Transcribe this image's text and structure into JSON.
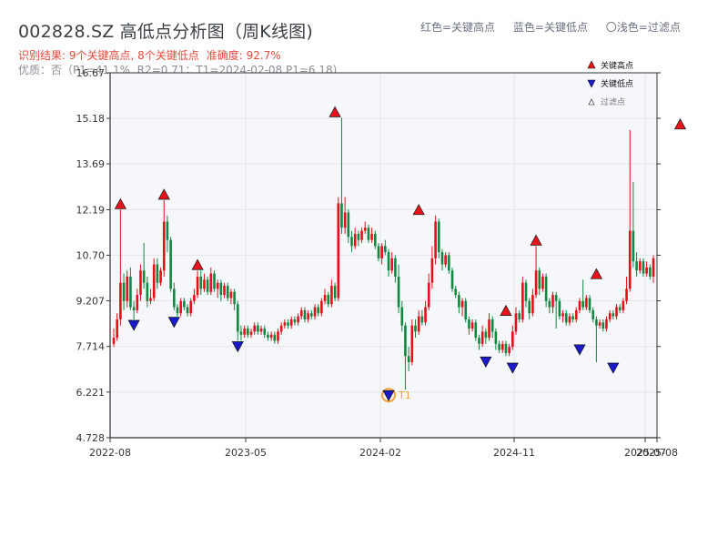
{
  "header": {
    "title": "002828.SZ 高低点分析图（周K线图)",
    "legend_line": [
      "红色=关键高点",
      "蓝色=关键低点",
      "〇浅色=过滤点"
    ],
    "result_text": "识别结果: 9个关键高点, 8个关键低点",
    "accuracy_text": "准确度: 92.7%",
    "quality_text": "优质：否（P1=41.1%, R2=0.71；T1=2024-02-08 P1=6.18)"
  },
  "colors": {
    "up": "#e3101a",
    "down": "#12873f",
    "high": "#e8141c",
    "low": "#1a1acb",
    "t1": "#f0a13a",
    "plot_bg": "#f5f7fa"
  },
  "chart_data": {
    "type": "candlestick",
    "ylim": [
      4.728,
      16.67
    ],
    "yticks": [
      "4.728",
      "6.221",
      "7.714",
      "9.207",
      "10.70",
      "12.19",
      "13.69",
      "15.18",
      "16.67"
    ],
    "xticks": [
      "2022-08",
      "2023-05",
      "2024-02",
      "2024-11",
      "2025-07",
      "2025-08"
    ],
    "legend": [
      "关键高点",
      "关键低点",
      "过滤点"
    ],
    "grid": true,
    "annotation": "T1",
    "candles": [
      {
        "o": 7.8,
        "c": 8.0,
        "h": 8.3,
        "l": 7.7
      },
      {
        "o": 8.0,
        "c": 8.6,
        "h": 8.8,
        "l": 7.9
      },
      {
        "o": 8.6,
        "c": 9.8,
        "h": 12.2,
        "l": 8.4
      },
      {
        "o": 9.8,
        "c": 9.2,
        "h": 10.1,
        "l": 8.9
      },
      {
        "o": 9.2,
        "c": 10.0,
        "h": 10.2,
        "l": 9.0
      },
      {
        "o": 10.0,
        "c": 9.0,
        "h": 10.3,
        "l": 8.9
      },
      {
        "o": 9.0,
        "c": 8.9,
        "h": 9.2,
        "l": 8.6
      },
      {
        "o": 8.9,
        "c": 9.4,
        "h": 9.6,
        "l": 8.8
      },
      {
        "o": 9.4,
        "c": 10.2,
        "h": 10.4,
        "l": 9.2
      },
      {
        "o": 10.2,
        "c": 9.8,
        "h": 11.1,
        "l": 9.6
      },
      {
        "o": 9.8,
        "c": 9.2,
        "h": 10.0,
        "l": 9.0
      },
      {
        "o": 9.2,
        "c": 9.3,
        "h": 9.6,
        "l": 9.1
      },
      {
        "o": 9.3,
        "c": 10.4,
        "h": 10.6,
        "l": 9.2
      },
      {
        "o": 10.4,
        "c": 9.8,
        "h": 10.6,
        "l": 9.6
      },
      {
        "o": 9.8,
        "c": 10.2,
        "h": 10.3,
        "l": 9.7
      },
      {
        "o": 10.2,
        "c": 11.8,
        "h": 12.5,
        "l": 10.0
      },
      {
        "o": 11.8,
        "c": 11.2,
        "h": 12.0,
        "l": 10.8
      },
      {
        "o": 11.2,
        "c": 9.6,
        "h": 11.3,
        "l": 9.5
      },
      {
        "o": 9.6,
        "c": 9.0,
        "h": 9.8,
        "l": 8.9
      },
      {
        "o": 9.0,
        "c": 8.8,
        "h": 9.1,
        "l": 8.7
      },
      {
        "o": 8.8,
        "c": 9.2,
        "h": 9.3,
        "l": 8.7
      },
      {
        "o": 9.2,
        "c": 9.0,
        "h": 9.3,
        "l": 8.9
      },
      {
        "o": 9.0,
        "c": 8.8,
        "h": 9.1,
        "l": 8.7
      },
      {
        "o": 8.8,
        "c": 9.2,
        "h": 9.3,
        "l": 8.7
      },
      {
        "o": 9.2,
        "c": 9.4,
        "h": 9.6,
        "l": 9.1
      },
      {
        "o": 9.4,
        "c": 10.0,
        "h": 10.2,
        "l": 9.3
      },
      {
        "o": 10.0,
        "c": 9.6,
        "h": 10.2,
        "l": 9.4
      },
      {
        "o": 9.6,
        "c": 9.9,
        "h": 10.1,
        "l": 9.5
      },
      {
        "o": 9.9,
        "c": 9.5,
        "h": 10.0,
        "l": 9.4
      },
      {
        "o": 9.5,
        "c": 10.1,
        "h": 10.3,
        "l": 9.4
      },
      {
        "o": 10.1,
        "c": 9.6,
        "h": 10.2,
        "l": 9.5
      },
      {
        "o": 9.6,
        "c": 9.8,
        "h": 9.9,
        "l": 9.3
      },
      {
        "o": 9.8,
        "c": 9.4,
        "h": 9.9,
        "l": 9.2
      },
      {
        "o": 9.4,
        "c": 9.7,
        "h": 9.8,
        "l": 9.3
      },
      {
        "o": 9.7,
        "c": 9.3,
        "h": 9.8,
        "l": 9.2
      },
      {
        "o": 9.3,
        "c": 9.5,
        "h": 9.6,
        "l": 9.1
      },
      {
        "o": 9.5,
        "c": 9.1,
        "h": 9.6,
        "l": 8.9
      },
      {
        "o": 9.1,
        "c": 8.2,
        "h": 9.2,
        "l": 7.9
      },
      {
        "o": 8.2,
        "c": 8.1,
        "h": 8.4,
        "l": 7.9
      },
      {
        "o": 8.1,
        "c": 8.3,
        "h": 8.4,
        "l": 8.0
      },
      {
        "o": 8.3,
        "c": 8.1,
        "h": 8.4,
        "l": 8.0
      },
      {
        "o": 8.1,
        "c": 8.2,
        "h": 8.3,
        "l": 8.0
      },
      {
        "o": 8.2,
        "c": 8.4,
        "h": 8.5,
        "l": 8.1
      },
      {
        "o": 8.4,
        "c": 8.2,
        "h": 8.5,
        "l": 8.1
      },
      {
        "o": 8.2,
        "c": 8.3,
        "h": 8.4,
        "l": 8.1
      },
      {
        "o": 8.3,
        "c": 8.1,
        "h": 8.4,
        "l": 8.0
      },
      {
        "o": 8.1,
        "c": 8.0,
        "h": 8.2,
        "l": 7.9
      },
      {
        "o": 8.0,
        "c": 8.1,
        "h": 8.2,
        "l": 7.9
      },
      {
        "o": 8.1,
        "c": 7.9,
        "h": 8.2,
        "l": 7.8
      },
      {
        "o": 7.9,
        "c": 8.2,
        "h": 8.3,
        "l": 7.8
      },
      {
        "o": 8.2,
        "c": 8.4,
        "h": 8.5,
        "l": 8.1
      },
      {
        "o": 8.4,
        "c": 8.5,
        "h": 8.6,
        "l": 8.3
      },
      {
        "o": 8.5,
        "c": 8.4,
        "h": 8.6,
        "l": 8.3
      },
      {
        "o": 8.4,
        "c": 8.6,
        "h": 8.7,
        "l": 8.3
      },
      {
        "o": 8.6,
        "c": 8.5,
        "h": 8.7,
        "l": 8.4
      },
      {
        "o": 8.5,
        "c": 8.7,
        "h": 8.8,
        "l": 8.4
      },
      {
        "o": 8.7,
        "c": 8.9,
        "h": 9.0,
        "l": 8.6
      },
      {
        "o": 8.9,
        "c": 8.6,
        "h": 9.0,
        "l": 8.5
      },
      {
        "o": 8.6,
        "c": 8.8,
        "h": 8.9,
        "l": 8.5
      },
      {
        "o": 8.8,
        "c": 8.7,
        "h": 8.9,
        "l": 8.6
      },
      {
        "o": 8.7,
        "c": 9.0,
        "h": 9.1,
        "l": 8.6
      },
      {
        "o": 9.0,
        "c": 8.8,
        "h": 9.1,
        "l": 8.7
      },
      {
        "o": 8.8,
        "c": 9.2,
        "h": 9.3,
        "l": 8.7
      },
      {
        "o": 9.2,
        "c": 9.4,
        "h": 9.6,
        "l": 9.1
      },
      {
        "o": 9.4,
        "c": 9.1,
        "h": 9.5,
        "l": 9.0
      },
      {
        "o": 9.1,
        "c": 9.7,
        "h": 9.9,
        "l": 9.0
      },
      {
        "o": 9.7,
        "c": 9.3,
        "h": 9.8,
        "l": 9.2
      },
      {
        "o": 9.3,
        "c": 12.4,
        "h": 12.6,
        "l": 9.2
      },
      {
        "o": 12.4,
        "c": 11.6,
        "h": 15.2,
        "l": 11.4
      },
      {
        "o": 11.6,
        "c": 12.1,
        "h": 12.6,
        "l": 11.4
      },
      {
        "o": 12.1,
        "c": 11.3,
        "h": 12.2,
        "l": 11.1
      },
      {
        "o": 11.3,
        "c": 11.0,
        "h": 11.5,
        "l": 10.8
      },
      {
        "o": 11.0,
        "c": 11.4,
        "h": 11.6,
        "l": 10.9
      },
      {
        "o": 11.4,
        "c": 11.2,
        "h": 11.5,
        "l": 11.0
      },
      {
        "o": 11.2,
        "c": 11.5,
        "h": 11.6,
        "l": 11.1
      },
      {
        "o": 11.5,
        "c": 11.6,
        "h": 11.8,
        "l": 11.4
      },
      {
        "o": 11.6,
        "c": 11.2,
        "h": 11.7,
        "l": 11.1
      },
      {
        "o": 11.2,
        "c": 11.4,
        "h": 11.6,
        "l": 11.1
      },
      {
        "o": 11.4,
        "c": 11.0,
        "h": 11.5,
        "l": 10.9
      },
      {
        "o": 11.0,
        "c": 10.6,
        "h": 11.1,
        "l": 10.5
      },
      {
        "o": 10.6,
        "c": 11.0,
        "h": 11.1,
        "l": 10.4
      },
      {
        "o": 11.0,
        "c": 10.8,
        "h": 11.2,
        "l": 10.7
      },
      {
        "o": 10.8,
        "c": 10.2,
        "h": 10.9,
        "l": 10.0
      },
      {
        "o": 10.2,
        "c": 10.6,
        "h": 10.8,
        "l": 10.1
      },
      {
        "o": 10.6,
        "c": 10.0,
        "h": 10.7,
        "l": 9.8
      },
      {
        "o": 10.0,
        "c": 9.0,
        "h": 10.4,
        "l": 8.8
      },
      {
        "o": 9.0,
        "c": 8.4,
        "h": 9.2,
        "l": 8.2
      },
      {
        "o": 8.4,
        "c": 7.4,
        "h": 8.5,
        "l": 6.3
      },
      {
        "o": 7.4,
        "c": 7.2,
        "h": 7.7,
        "l": 6.9
      },
      {
        "o": 7.2,
        "c": 8.4,
        "h": 8.6,
        "l": 7.1
      },
      {
        "o": 8.4,
        "c": 8.2,
        "h": 8.6,
        "l": 8.0
      },
      {
        "o": 8.2,
        "c": 8.7,
        "h": 8.9,
        "l": 8.1
      },
      {
        "o": 8.7,
        "c": 8.5,
        "h": 8.9,
        "l": 8.4
      },
      {
        "o": 8.5,
        "c": 9.0,
        "h": 9.2,
        "l": 8.4
      },
      {
        "o": 9.0,
        "c": 9.8,
        "h": 10.1,
        "l": 8.9
      },
      {
        "o": 9.8,
        "c": 10.6,
        "h": 11.0,
        "l": 9.6
      },
      {
        "o": 10.6,
        "c": 11.8,
        "h": 12.0,
        "l": 10.4
      },
      {
        "o": 11.8,
        "c": 10.8,
        "h": 11.9,
        "l": 10.6
      },
      {
        "o": 10.8,
        "c": 10.4,
        "h": 10.9,
        "l": 10.2
      },
      {
        "o": 10.4,
        "c": 10.7,
        "h": 10.8,
        "l": 10.3
      },
      {
        "o": 10.7,
        "c": 10.2,
        "h": 10.8,
        "l": 10.1
      },
      {
        "o": 10.2,
        "c": 9.6,
        "h": 10.3,
        "l": 9.5
      },
      {
        "o": 9.6,
        "c": 9.4,
        "h": 9.7,
        "l": 9.3
      },
      {
        "o": 9.4,
        "c": 9.0,
        "h": 9.5,
        "l": 8.8
      },
      {
        "o": 9.0,
        "c": 9.2,
        "h": 9.3,
        "l": 8.7
      },
      {
        "o": 9.2,
        "c": 8.6,
        "h": 9.3,
        "l": 8.5
      },
      {
        "o": 8.6,
        "c": 8.3,
        "h": 8.7,
        "l": 8.1
      },
      {
        "o": 8.3,
        "c": 8.5,
        "h": 8.6,
        "l": 8.2
      },
      {
        "o": 8.5,
        "c": 8.0,
        "h": 8.6,
        "l": 7.9
      },
      {
        "o": 8.0,
        "c": 7.8,
        "h": 8.1,
        "l": 7.6
      },
      {
        "o": 7.8,
        "c": 8.2,
        "h": 8.4,
        "l": 7.7
      },
      {
        "o": 8.2,
        "c": 8.0,
        "h": 8.3,
        "l": 7.8
      },
      {
        "o": 8.0,
        "c": 8.6,
        "h": 8.8,
        "l": 7.9
      },
      {
        "o": 8.6,
        "c": 8.2,
        "h": 8.7,
        "l": 8.0
      },
      {
        "o": 8.2,
        "c": 7.8,
        "h": 8.3,
        "l": 7.6
      },
      {
        "o": 7.8,
        "c": 7.6,
        "h": 7.9,
        "l": 7.5
      },
      {
        "o": 7.6,
        "c": 7.8,
        "h": 7.9,
        "l": 7.5
      },
      {
        "o": 7.8,
        "c": 7.5,
        "h": 7.9,
        "l": 7.4
      },
      {
        "o": 7.5,
        "c": 7.7,
        "h": 7.8,
        "l": 7.4
      },
      {
        "o": 7.7,
        "c": 8.2,
        "h": 8.4,
        "l": 7.6
      },
      {
        "o": 8.2,
        "c": 8.8,
        "h": 9.0,
        "l": 8.1
      },
      {
        "o": 8.8,
        "c": 8.6,
        "h": 8.9,
        "l": 8.5
      },
      {
        "o": 8.6,
        "c": 9.8,
        "h": 10.0,
        "l": 8.5
      },
      {
        "o": 9.8,
        "c": 9.2,
        "h": 9.9,
        "l": 9.0
      },
      {
        "o": 9.2,
        "c": 8.8,
        "h": 9.3,
        "l": 8.6
      },
      {
        "o": 8.8,
        "c": 9.4,
        "h": 9.6,
        "l": 8.7
      },
      {
        "o": 9.4,
        "c": 10.2,
        "h": 11.0,
        "l": 9.3
      },
      {
        "o": 10.2,
        "c": 9.6,
        "h": 10.3,
        "l": 9.4
      },
      {
        "o": 9.6,
        "c": 10.0,
        "h": 10.1,
        "l": 9.5
      },
      {
        "o": 10.0,
        "c": 9.2,
        "h": 10.1,
        "l": 9.0
      },
      {
        "o": 9.2,
        "c": 9.0,
        "h": 9.3,
        "l": 8.8
      },
      {
        "o": 9.0,
        "c": 9.4,
        "h": 9.5,
        "l": 8.8
      },
      {
        "o": 9.4,
        "c": 9.2,
        "h": 9.5,
        "l": 8.3
      },
      {
        "o": 9.2,
        "c": 8.7,
        "h": 9.3,
        "l": 8.6
      },
      {
        "o": 8.7,
        "c": 8.8,
        "h": 8.9,
        "l": 8.5
      },
      {
        "o": 8.8,
        "c": 8.5,
        "h": 8.9,
        "l": 8.4
      },
      {
        "o": 8.5,
        "c": 8.7,
        "h": 8.8,
        "l": 8.4
      },
      {
        "o": 8.7,
        "c": 8.6,
        "h": 8.8,
        "l": 8.5
      },
      {
        "o": 8.6,
        "c": 8.9,
        "h": 9.0,
        "l": 8.5
      },
      {
        "o": 8.9,
        "c": 9.2,
        "h": 9.3,
        "l": 8.8
      },
      {
        "o": 9.2,
        "c": 9.0,
        "h": 9.9,
        "l": 8.9
      },
      {
        "o": 9.0,
        "c": 9.3,
        "h": 9.4,
        "l": 8.9
      },
      {
        "o": 9.3,
        "c": 8.9,
        "h": 9.4,
        "l": 8.8
      },
      {
        "o": 8.9,
        "c": 8.6,
        "h": 9.0,
        "l": 8.5
      },
      {
        "o": 8.6,
        "c": 8.4,
        "h": 8.7,
        "l": 7.2
      },
      {
        "o": 8.4,
        "c": 8.5,
        "h": 8.6,
        "l": 8.3
      },
      {
        "o": 8.5,
        "c": 8.3,
        "h": 8.6,
        "l": 8.2
      },
      {
        "o": 8.3,
        "c": 8.6,
        "h": 8.7,
        "l": 8.2
      },
      {
        "o": 8.6,
        "c": 8.8,
        "h": 8.9,
        "l": 8.5
      },
      {
        "o": 8.8,
        "c": 8.7,
        "h": 8.9,
        "l": 8.6
      },
      {
        "o": 8.7,
        "c": 9.0,
        "h": 9.1,
        "l": 8.6
      },
      {
        "o": 9.0,
        "c": 8.9,
        "h": 9.1,
        "l": 8.8
      },
      {
        "o": 8.9,
        "c": 9.2,
        "h": 9.3,
        "l": 8.8
      },
      {
        "o": 9.2,
        "c": 9.6,
        "h": 10.0,
        "l": 9.1
      },
      {
        "o": 9.6,
        "c": 11.5,
        "h": 14.8,
        "l": 9.5
      },
      {
        "o": 11.5,
        "c": 10.5,
        "h": 13.1,
        "l": 10.3
      },
      {
        "o": 10.5,
        "c": 10.2,
        "h": 10.8,
        "l": 10.0
      },
      {
        "o": 10.2,
        "c": 10.5,
        "h": 10.6,
        "l": 10.1
      },
      {
        "o": 10.5,
        "c": 10.1,
        "h": 10.6,
        "l": 10.0
      },
      {
        "o": 10.1,
        "c": 10.3,
        "h": 10.5,
        "l": 10.0
      },
      {
        "o": 10.3,
        "c": 10.0,
        "h": 10.4,
        "l": 9.9
      },
      {
        "o": 10.0,
        "c": 10.6,
        "h": 10.7,
        "l": 9.8
      }
    ],
    "key_highs": [
      {
        "i": 2,
        "v": 12.19
      },
      {
        "i": 15,
        "v": 12.5
      },
      {
        "i": 25,
        "v": 10.2
      },
      {
        "i": 66,
        "v": 15.2
      },
      {
        "i": 91,
        "v": 12.0
      },
      {
        "i": 117,
        "v": 8.7
      },
      {
        "i": 126,
        "v": 11.0
      },
      {
        "i": 144,
        "v": 9.9
      },
      {
        "i": 169,
        "v": 14.8
      }
    ],
    "key_lows": [
      {
        "i": 6,
        "v": 8.6
      },
      {
        "i": 18,
        "v": 8.7
      },
      {
        "i": 37,
        "v": 7.9
      },
      {
        "i": 82,
        "v": 6.3
      },
      {
        "i": 111,
        "v": 7.4
      },
      {
        "i": 119,
        "v": 7.2
      },
      {
        "i": 139,
        "v": 7.8
      },
      {
        "i": 149,
        "v": 7.2
      }
    ],
    "t1_index": 82
  }
}
